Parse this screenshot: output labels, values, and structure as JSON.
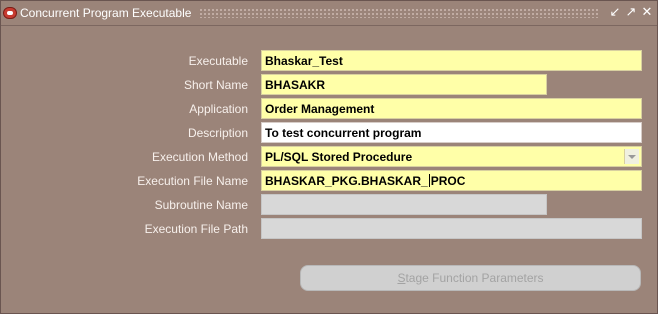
{
  "window": {
    "title": "Concurrent Program Executable",
    "controls": [
      "minimize-icon",
      "maximize-icon",
      "close-icon"
    ]
  },
  "form": {
    "executable": {
      "label": "Executable",
      "value": "Bhaskar_Test"
    },
    "short_name": {
      "label": "Short Name",
      "value": "BHASAKR"
    },
    "application": {
      "label": "Application",
      "value": "Order Management"
    },
    "description": {
      "label": "Description",
      "value": "To test concurrent program"
    },
    "execution_method": {
      "label": "Execution Method",
      "value": "PL/SQL Stored Procedure"
    },
    "execution_file_name": {
      "label": "Execution File Name",
      "value_before_cursor": "BHASKAR_PKG.BHASKAR_",
      "value_after_cursor": "PROC"
    },
    "subroutine_name": {
      "label": "Subroutine Name",
      "value": ""
    },
    "execution_file_path": {
      "label": "Execution File Path",
      "value": ""
    }
  },
  "buttons": {
    "stage_mnemonic": "S",
    "stage_rest": "tage Function Parameters"
  },
  "colors": {
    "background": "#9b8479",
    "required_field": "#ffffa8",
    "optional_field": "#ffffff",
    "disabled_field": "#d8d8d8"
  }
}
